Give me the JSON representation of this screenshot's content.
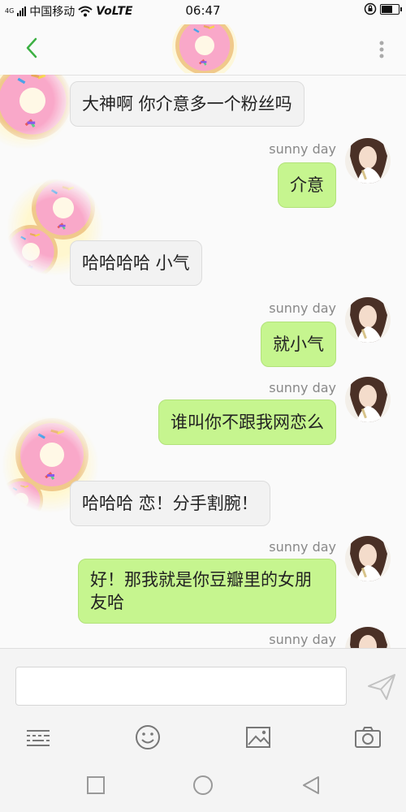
{
  "status_bar": {
    "network_small": "4G",
    "carrier": "中国移动",
    "volte": "VoLTE",
    "time": "06:47",
    "battery_level": 0.6
  },
  "header": {
    "back_icon": "chevron-left-icon",
    "more_icon": "more-vertical-icon",
    "avatar": "donut-avatar"
  },
  "messages": [
    {
      "side": "in",
      "text": "大神啊 你介意多一个粉丝吗"
    },
    {
      "side": "out",
      "sender": "sunny day",
      "text": "介意"
    },
    {
      "side": "in",
      "text": "哈哈哈哈 小气"
    },
    {
      "side": "out",
      "sender": "sunny day",
      "text": "就小气"
    },
    {
      "side": "out",
      "sender": "sunny day",
      "text": "谁叫你不跟我网恋么"
    },
    {
      "side": "in",
      "text": "哈哈哈 恋！分手割腕！"
    },
    {
      "side": "out",
      "sender": "sunny day",
      "text": "好！那我就是你豆瓣里的女朋友哈"
    },
    {
      "side": "out",
      "sender": "sunny day",
      "text": ""
    }
  ],
  "input": {
    "value": "",
    "placeholder": "",
    "send_icon": "send-icon"
  },
  "toolbar": {
    "icons": [
      "keyboard-icon",
      "emoji-icon",
      "image-icon",
      "camera-icon"
    ]
  },
  "nav": {
    "icons": [
      "recents-icon",
      "home-icon",
      "back-icon"
    ]
  },
  "colors": {
    "out_bubble": "#c6f58f",
    "in_bubble": "#f2f2f2",
    "accent": "#3cb043"
  }
}
